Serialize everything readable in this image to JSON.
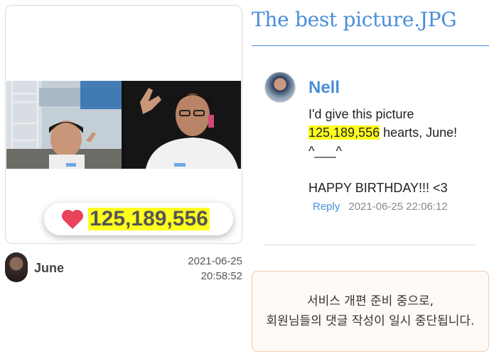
{
  "post": {
    "like_count": "125,189,556",
    "author": "June",
    "date": "2021-06-25",
    "time": "20:58:52"
  },
  "title": "The best picture.JPG",
  "comment": {
    "author": "Nell",
    "text_before": "I'd give this picture\n",
    "text_highlight": "125,189,556",
    "text_after": " hearts, June!\n^___^\n\nHAPPY BIRTHDAY!!! <3",
    "reply_label": "Reply",
    "timestamp": "2021-06-25 22:06:12"
  },
  "notice": "서비스 개편 준비 중으로,\n회원님들의 댓글 작성이 일시 중단됩니다.",
  "colors": {
    "accent": "#4a8ed8",
    "heart": "#e8435a",
    "highlight": "#ffff1e"
  }
}
